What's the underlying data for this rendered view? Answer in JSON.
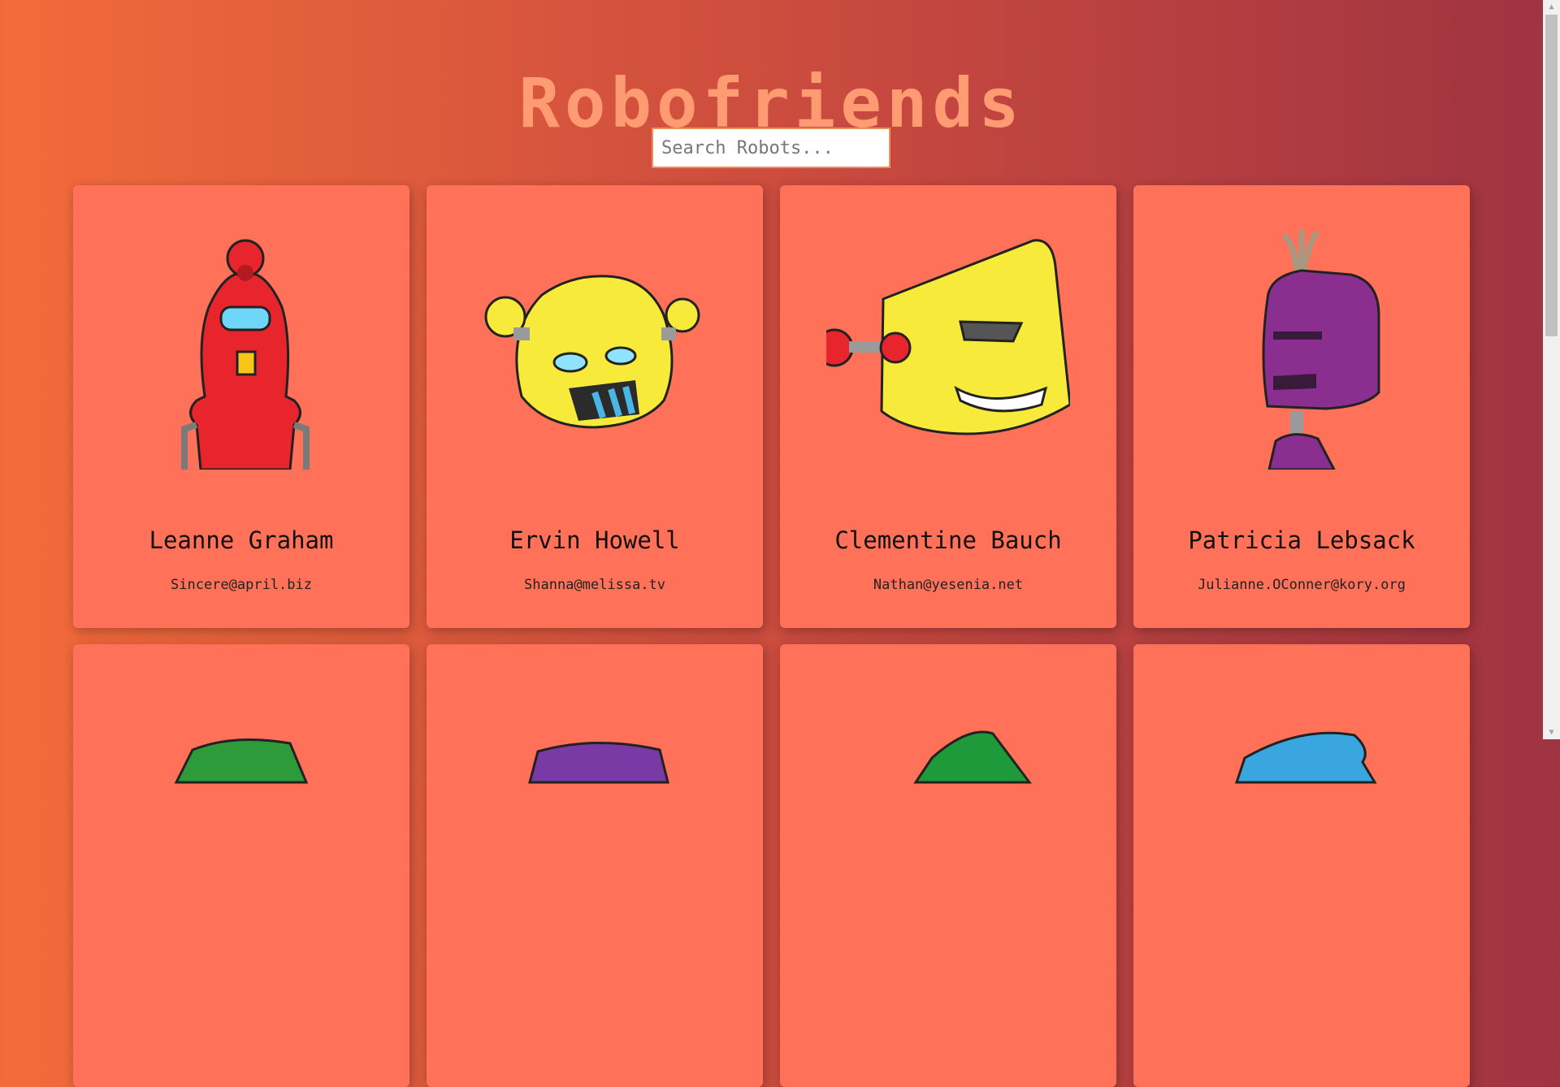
{
  "app": {
    "title": "Robofriends"
  },
  "search": {
    "placeholder": "Search Robots...",
    "value": ""
  },
  "robots": [
    {
      "name": "Leanne Graham",
      "email": "Sincere@april.biz",
      "color": "#e8242c"
    },
    {
      "name": "Ervin Howell",
      "email": "Shanna@melissa.tv",
      "color": "#f7ea3a"
    },
    {
      "name": "Clementine Bauch",
      "email": "Nathan@yesenia.net",
      "color": "#f7ea3a"
    },
    {
      "name": "Patricia Lebsack",
      "email": "Julianne.OConner@kory.org",
      "color": "#8a2f8f"
    },
    {
      "name": "",
      "email": "",
      "color": "#2e9b3a"
    },
    {
      "name": "",
      "email": "",
      "color": "#7a3aa6"
    },
    {
      "name": "",
      "email": "",
      "color": "#1e9a3a"
    },
    {
      "name": "",
      "email": "",
      "color": "#3aa6e0"
    }
  ],
  "colors": {
    "card": "#ff7159",
    "title": "#ff9b72",
    "search_border": "#e8935e"
  },
  "icons": {
    "scroll_up": "▲",
    "scroll_down": "▼"
  }
}
